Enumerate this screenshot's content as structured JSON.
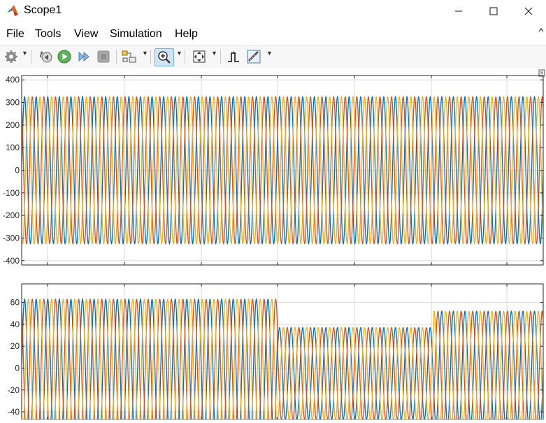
{
  "window": {
    "title": "Scope1"
  },
  "menu": [
    "File",
    "Tools",
    "View",
    "Simulation",
    "Help"
  ],
  "toolbar": {
    "buttons": [
      "settings-icon",
      "step-back-icon",
      "run-icon",
      "step-forward-icon",
      "stop-icon",
      "highlight-block-icon",
      "zoom-in-icon",
      "zoom-to-fit-icon",
      "triggers-icon",
      "cursor-measurements-icon"
    ]
  },
  "colors": {
    "phase_a": "#0072BD",
    "phase_b": "#D95319",
    "phase_c": "#EDB120",
    "grid": "#d9d9d9"
  },
  "chart_data": [
    {
      "type": "line",
      "title": "",
      "xlabel": "",
      "ylabel": "",
      "ylim": [
        -410,
        410
      ],
      "yticks": [
        400,
        300,
        200,
        100,
        0,
        -100,
        -200,
        -300,
        -400
      ],
      "grid": true,
      "series": [
        {
          "color": "#0072BD",
          "waveform": "sine",
          "cycles": 45,
          "segments": [
            {
              "x_from": 0,
              "x_to": 1,
              "amplitude": 325,
              "offset": 0
            }
          ]
        },
        {
          "color": "#D95319",
          "waveform": "sine",
          "cycles": 45,
          "segments": [
            {
              "x_from": 0,
              "x_to": 1,
              "amplitude": 325,
              "offset": 0
            }
          ]
        },
        {
          "color": "#EDB120",
          "waveform": "sine",
          "cycles": 45,
          "segments": [
            {
              "x_from": 0,
              "x_to": 1,
              "amplitude": 325,
              "offset": 0
            }
          ]
        }
      ]
    },
    {
      "type": "line",
      "title": "",
      "xlabel": "",
      "ylabel": "",
      "ylim": [
        -47,
        77
      ],
      "yticks": [
        60,
        40,
        20,
        0,
        -20,
        -40
      ],
      "grid": true,
      "series": [
        {
          "color": "#0072BD",
          "waveform": "sine",
          "cycles": 45,
          "segments": [
            {
              "x_from": 0,
              "x_to": 0.49,
              "amplitude": 63,
              "offset": 0
            },
            {
              "x_from": 0.49,
              "x_to": 0.79,
              "amplitude": 42,
              "offset": -5
            },
            {
              "x_from": 0.79,
              "x_to": 1,
              "amplitude": 52,
              "offset": 0
            }
          ]
        },
        {
          "color": "#D95319",
          "waveform": "sine",
          "cycles": 45,
          "segments": [
            {
              "x_from": 0,
              "x_to": 0.49,
              "amplitude": 63,
              "offset": 0
            },
            {
              "x_from": 0.49,
              "x_to": 0.79,
              "amplitude": 42,
              "offset": -5
            },
            {
              "x_from": 0.79,
              "x_to": 1,
              "amplitude": 52,
              "offset": 0
            }
          ]
        },
        {
          "color": "#EDB120",
          "waveform": "sine",
          "cycles": 45,
          "segments": [
            {
              "x_from": 0,
              "x_to": 0.49,
              "amplitude": 63,
              "offset": 0
            },
            {
              "x_from": 0.49,
              "x_to": 0.79,
              "amplitude": 42,
              "offset": -5
            },
            {
              "x_from": 0.79,
              "x_to": 1,
              "amplitude": 52,
              "offset": 0
            }
          ]
        }
      ]
    }
  ]
}
